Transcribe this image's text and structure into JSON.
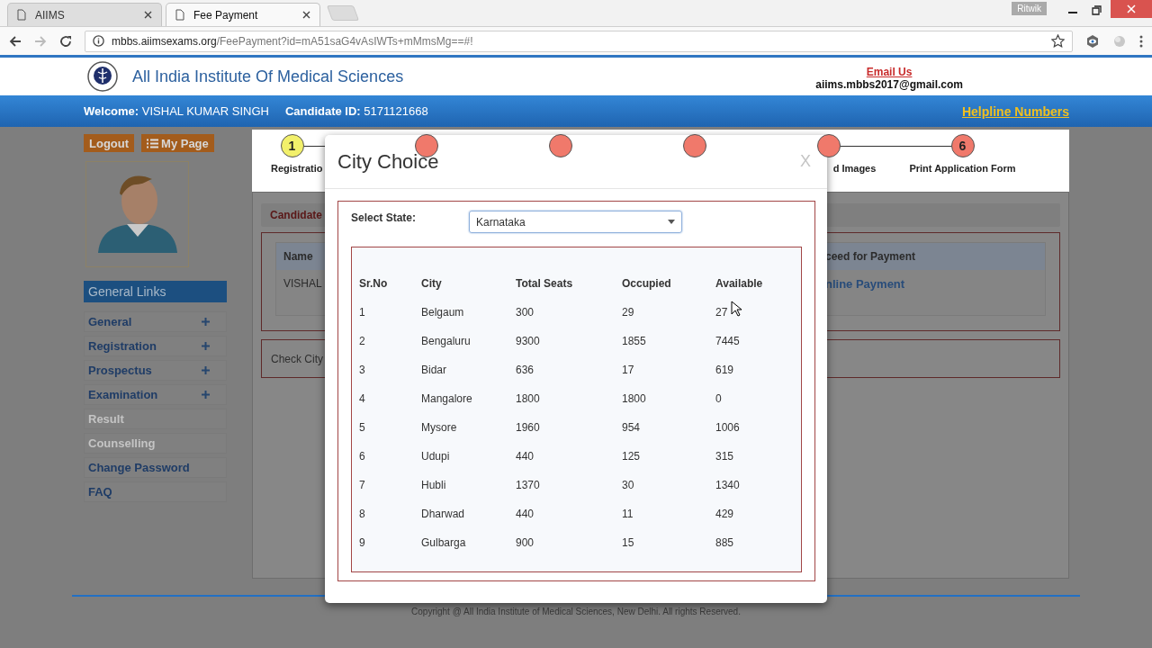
{
  "browser": {
    "tabs": [
      {
        "title": "AIIMS",
        "selected": false
      },
      {
        "title": "Fee Payment",
        "selected": true
      }
    ],
    "profile": "Ritwik",
    "url": {
      "domain": "mbbs.aiimsexams.org",
      "path": "/FeePayment?id=mA51saG4vAsIWTs+mMmsMg==#!"
    }
  },
  "header": {
    "title": "All India Institute Of Medical Sciences",
    "email_link": "Email Us",
    "email": "aiims.mbbs2017@gmail.com"
  },
  "welcome_bar": {
    "welcome_label": "Welcome:",
    "name": "VISHAL KUMAR SINGH",
    "id_label": "Candidate ID:",
    "candidate_id": "5171121668",
    "helpline_link": "Helpline Numbers"
  },
  "sidebar": {
    "buttons": [
      "Logout",
      "My Page"
    ],
    "links_title": "General Links",
    "items": [
      {
        "label": "General",
        "kind": "expandable",
        "expanded": false,
        "disabled": false
      },
      {
        "label": "Registration",
        "kind": "expandable",
        "expanded": false,
        "disabled": false
      },
      {
        "label": "Prospectus",
        "kind": "expandable",
        "expanded": false,
        "disabled": false
      },
      {
        "label": "Examination",
        "kind": "expandable",
        "expanded": false,
        "disabled": false
      },
      {
        "label": "Result",
        "kind": "link",
        "disabled": true
      },
      {
        "label": "Counselling",
        "kind": "link",
        "disabled": true
      },
      {
        "label": "Change Password",
        "kind": "link",
        "disabled": false
      },
      {
        "label": "FAQ",
        "kind": "link",
        "disabled": false
      }
    ]
  },
  "steps": [
    {
      "number": "1",
      "label": "Registratio",
      "color": "#f2f06b"
    },
    {
      "color": "#f0796b"
    },
    {
      "color": "#f0796b"
    },
    {
      "color": "#f0796b"
    },
    {
      "color": "#f0796b",
      "label": "d Images"
    },
    {
      "number": "6",
      "label": "Print Application Form",
      "color": "#f0796b"
    }
  ],
  "panel": {
    "section_title": "Candidate",
    "table_header": {
      "column_1": "Name",
      "column_2": "ceed for Payment"
    },
    "table_row": {
      "column_1": "VISHAL",
      "column_2": "nline Payment"
    },
    "check_city": "Check City"
  },
  "footer": {
    "copyright": "Copyright @ All India Institute of Medical Sciences, New Delhi. All rights Reserved."
  },
  "modal": {
    "title": "City Choice",
    "close": "X",
    "state_label": "Select State:",
    "state_value": "Karnataka",
    "columns": [
      "Sr.No",
      "City",
      "Total Seats",
      "Occupied",
      "Available"
    ],
    "rows": [
      [
        "1",
        "Belgaum",
        "300",
        "29",
        "27"
      ],
      [
        "2",
        "Bengaluru",
        "9300",
        "1855",
        "7445"
      ],
      [
        "3",
        "Bidar",
        "636",
        "17",
        "619"
      ],
      [
        "4",
        "Mangalore",
        "1800",
        "1800",
        "0"
      ],
      [
        "5",
        "Mysore",
        "1960",
        "954",
        "1006"
      ],
      [
        "6",
        "Udupi",
        "440",
        "125",
        "315"
      ],
      [
        "7",
        "Hubli",
        "1370",
        "30",
        "1340"
      ],
      [
        "8",
        "Dharwad",
        "440",
        "11",
        "429"
      ],
      [
        "9",
        "Gulbarga",
        "900",
        "15",
        "885"
      ]
    ]
  }
}
